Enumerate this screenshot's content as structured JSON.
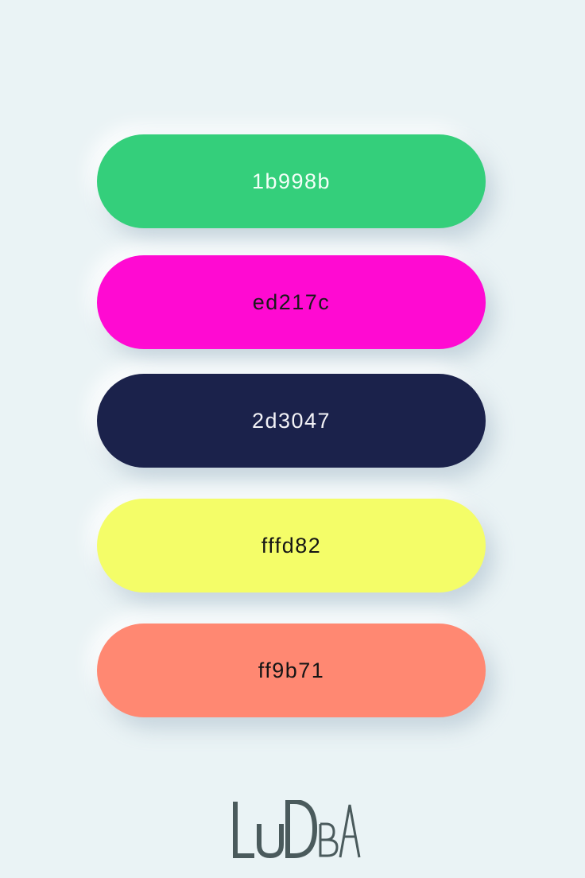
{
  "palette": [
    {
      "label": "1b998b",
      "color": "#34cf7b",
      "text_color": "#f4fff8"
    },
    {
      "label": "ed217c",
      "color": "#ff0ad2",
      "text_color": "#1a1a1a"
    },
    {
      "label": "2d3047",
      "color": "#1b224b",
      "text_color": "#f2f2f6"
    },
    {
      "label": "fffd82",
      "color": "#f4fd68",
      "text_color": "#151515"
    },
    {
      "label": "ff9b71",
      "color": "#ff8872",
      "text_color": "#151515"
    }
  ],
  "logo": {
    "text": "LUDBA",
    "color": "#4a5a5c"
  }
}
